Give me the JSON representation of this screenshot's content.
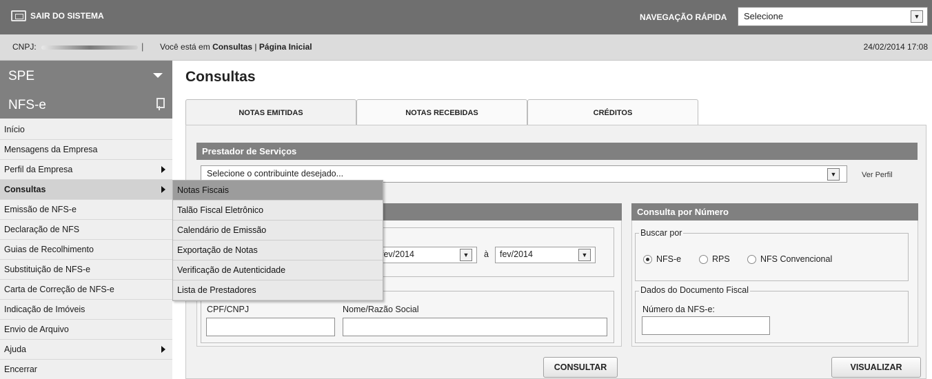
{
  "topbar": {
    "logout_label": "SAIR DO SISTEMA",
    "quick_nav_label": "NAVEGAÇÃO RÁPIDA",
    "quick_nav_value": "Selecione"
  },
  "infobar": {
    "cnpj_label": "CNPJ:",
    "separator": "|",
    "breadcrumb_prefix": "Você está em",
    "breadcrumb_section": "Consultas",
    "breadcrumb_divider": "|",
    "breadcrumb_page": "Página Inicial",
    "datetime": "24/02/2014 17:08"
  },
  "sidebar": {
    "module": "SPE",
    "submodule": "NFS-e",
    "items": [
      {
        "label": "Início"
      },
      {
        "label": "Mensagens da Empresa"
      },
      {
        "label": "Perfil da Empresa"
      },
      {
        "label": "Consultas"
      },
      {
        "label": "Emissão de NFS-e"
      },
      {
        "label": "Declaração de NFS"
      },
      {
        "label": "Guias de Recolhimento"
      },
      {
        "label": "Substituição de NFS-e"
      },
      {
        "label": "Carta de Correção de NFS-e"
      },
      {
        "label": "Indicação de Imóveis"
      },
      {
        "label": "Envio de Arquivo"
      },
      {
        "label": "Ajuda"
      },
      {
        "label": "Encerrar"
      }
    ]
  },
  "flyout": {
    "items": [
      {
        "label": "Notas Fiscais"
      },
      {
        "label": "Talão Fiscal Eletrônico"
      },
      {
        "label": "Calendário de Emissão"
      },
      {
        "label": "Exportação de Notas"
      },
      {
        "label": "Verificação de Autenticidade"
      },
      {
        "label": "Lista de Prestadores"
      }
    ]
  },
  "main": {
    "title": "Consultas",
    "tabs": [
      {
        "label": "NOTAS EMITIDAS"
      },
      {
        "label": "NOTAS RECEBIDAS"
      },
      {
        "label": "CRÉDITOS"
      }
    ],
    "prestador": {
      "heading": "Prestador de Serviços",
      "select_value": "Selecione o contribuinte desejado...",
      "profile_link": "Ver Perfil"
    },
    "period": {
      "from": "fev/2014",
      "separator": "à",
      "to": "fev/2014"
    },
    "document": {
      "cpf_label": "CPF/CNPJ",
      "name_label": "Nome/Razão Social",
      "cpf_value": "",
      "name_value": ""
    },
    "by_number": {
      "heading": "Consulta por Número",
      "search_legend": "Buscar por",
      "options": [
        {
          "label": "NFS-e",
          "selected": true
        },
        {
          "label": "RPS",
          "selected": false
        },
        {
          "label": "NFS Convencional",
          "selected": false
        }
      ],
      "doc_legend": "Dados do Documento Fiscal",
      "number_label": "Número da NFS-e:",
      "number_value": ""
    },
    "consult_button": "CONSULTAR",
    "view_button": "VISUALIZAR"
  },
  "colors": {
    "header_gray": "#6f6f6f",
    "section_gray": "#808080",
    "info_bar": "#dcdcdc"
  }
}
